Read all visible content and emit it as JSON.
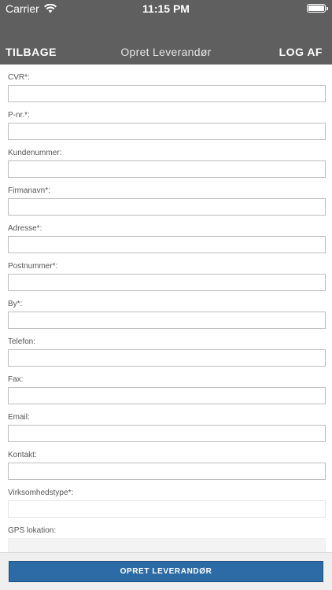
{
  "status_bar": {
    "carrier": "Carrier",
    "time": "11:15 PM",
    "wifi_icon": "wifi-icon",
    "battery_icon": "battery-icon"
  },
  "nav": {
    "back_label": "TILBAGE",
    "title": "Opret Leverandør",
    "logout_label": "LOG AF",
    "background_color": "#5f5f5f"
  },
  "form": {
    "fields": [
      {
        "label": "CVR*:",
        "value": "",
        "placeholder": ""
      },
      {
        "label": "P-nr.*:",
        "value": "",
        "placeholder": ""
      },
      {
        "label": "Kundenummer:",
        "value": "",
        "placeholder": ""
      },
      {
        "label": "Firmanavn*:",
        "value": "",
        "placeholder": ""
      },
      {
        "label": "Adresse*:",
        "value": "",
        "placeholder": ""
      },
      {
        "label": "Postnummer*:",
        "value": "",
        "placeholder": ""
      },
      {
        "label": "By*:",
        "value": "",
        "placeholder": ""
      },
      {
        "label": "Telefon:",
        "value": "",
        "placeholder": ""
      },
      {
        "label": "Fax:",
        "value": "",
        "placeholder": ""
      },
      {
        "label": "Email:",
        "value": "",
        "placeholder": ""
      },
      {
        "label": "Kontakt:",
        "value": "",
        "placeholder": ""
      },
      {
        "label": "Virksomhedstype*:",
        "value": "",
        "placeholder": ""
      },
      {
        "label": "GPS lokation:",
        "value": "",
        "placeholder": ""
      }
    ]
  },
  "footer": {
    "submit_label": "OPRET LEVERANDØR",
    "button_color": "#2d6ba6"
  }
}
